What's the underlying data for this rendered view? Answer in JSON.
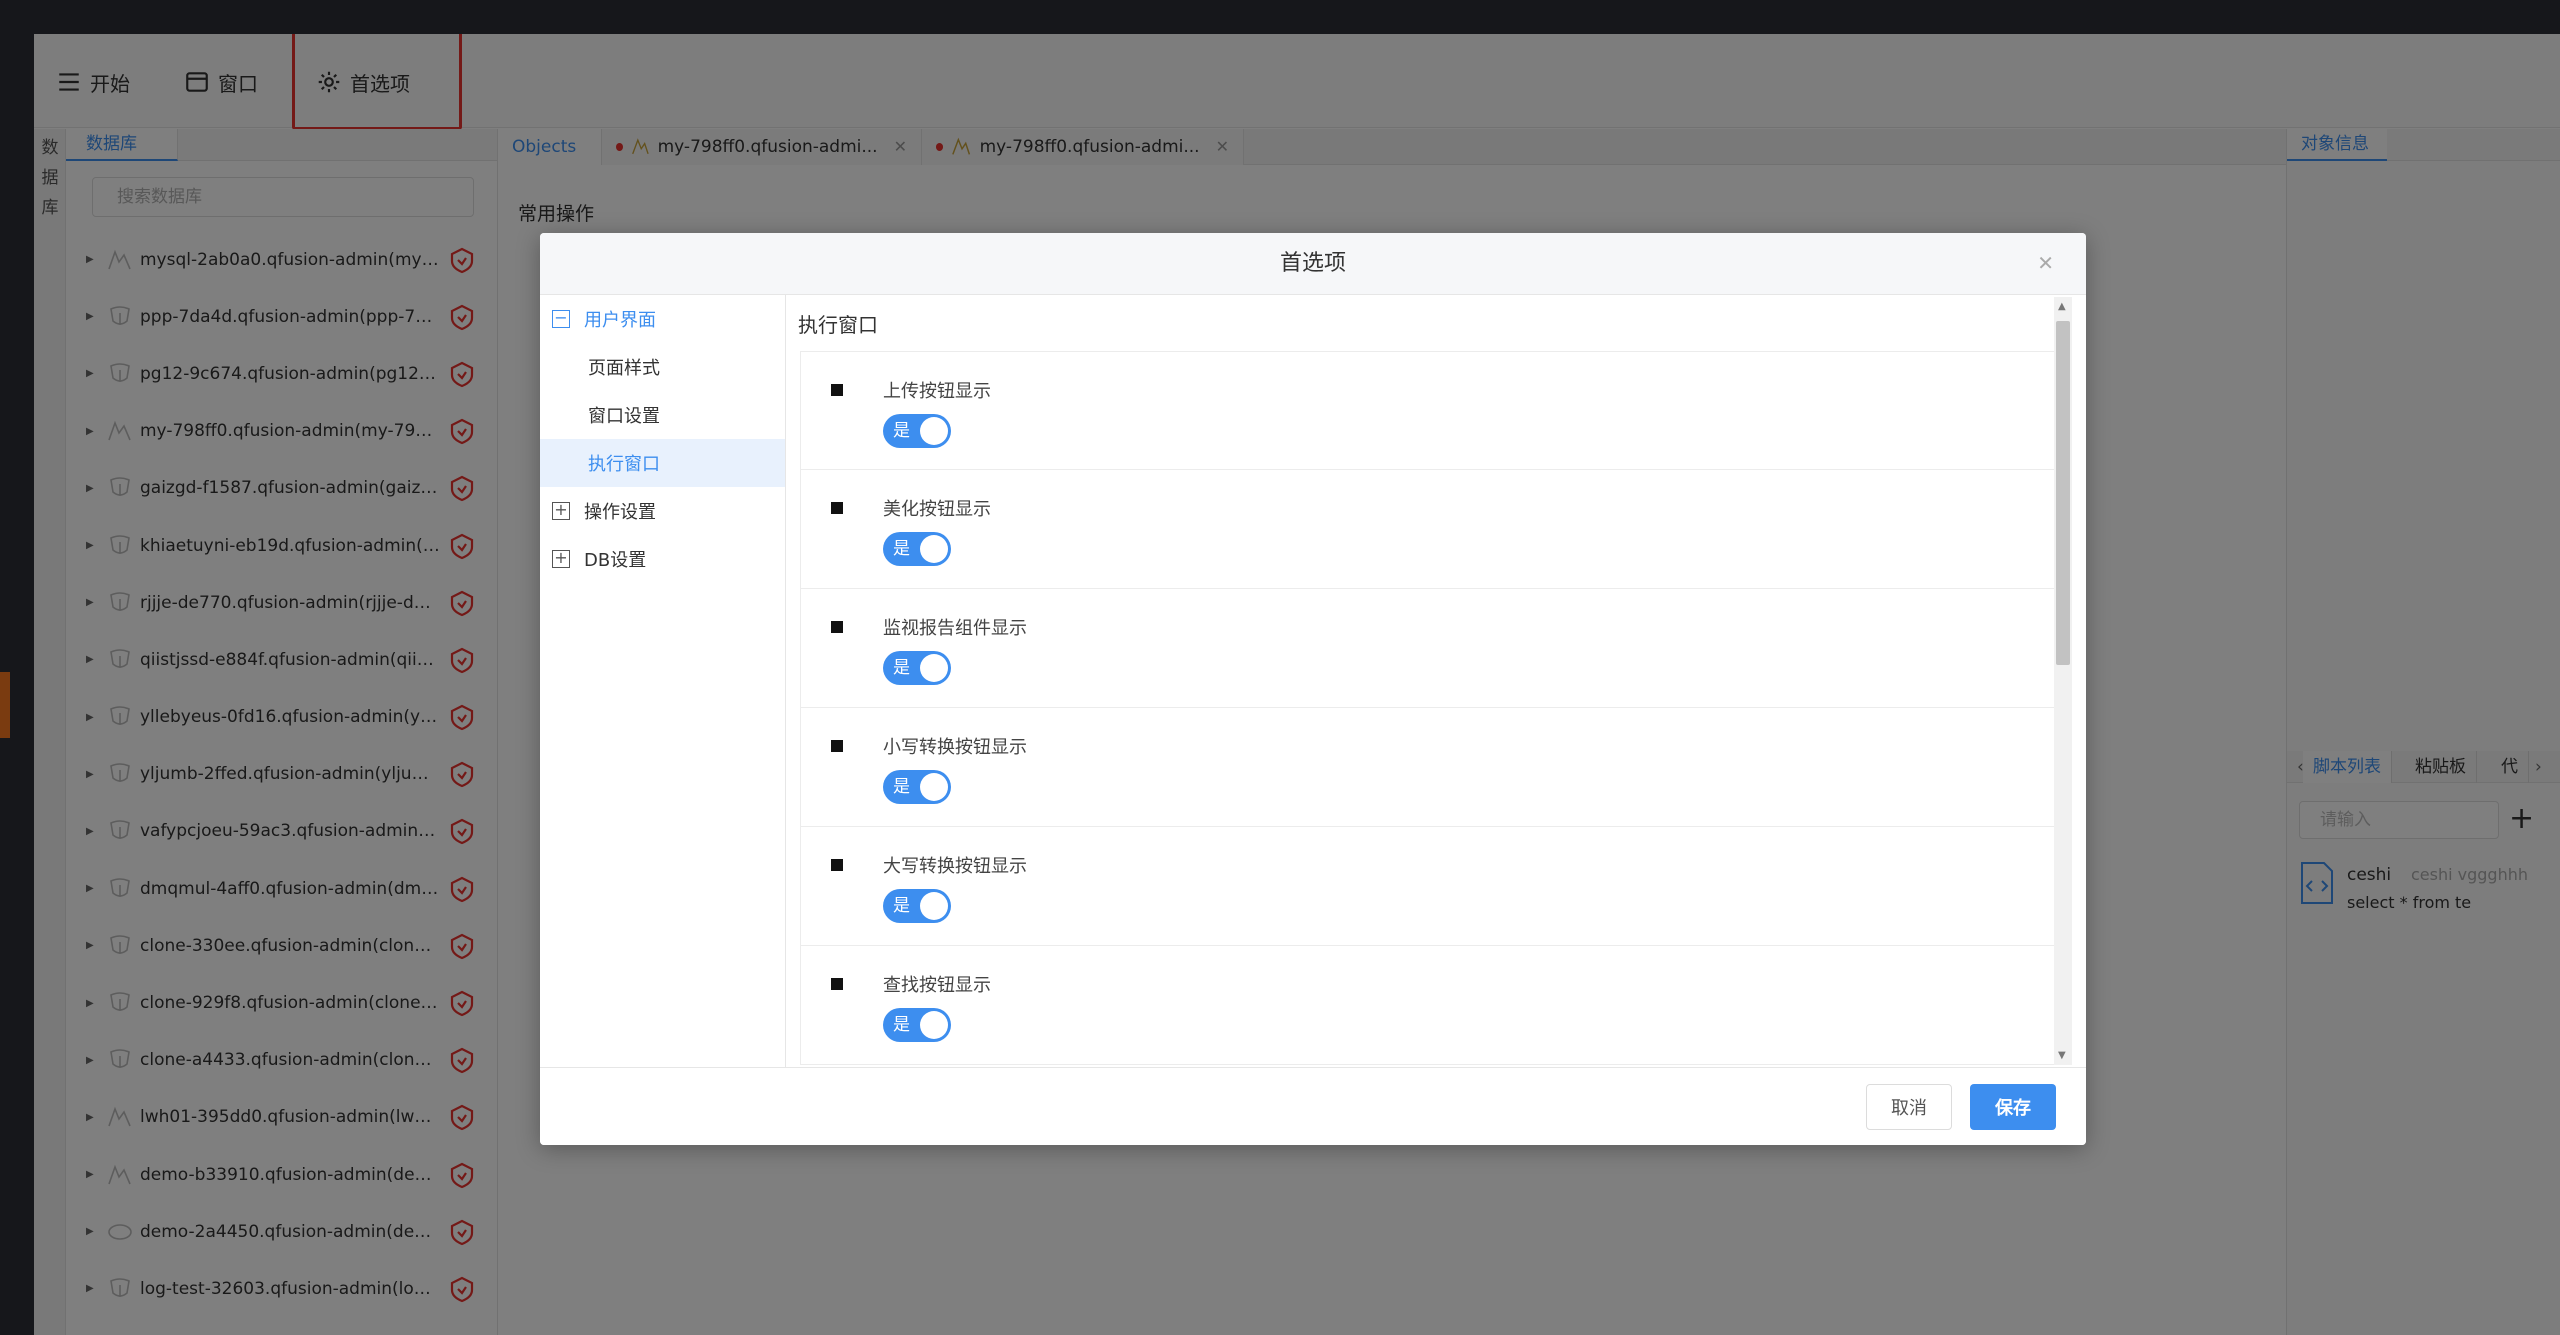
{
  "toolbar": {
    "start_label": "开始",
    "window_label": "窗口",
    "prefs_label": "首选项"
  },
  "left_strip": {
    "label_chars": [
      "数",
      "据",
      "库"
    ]
  },
  "left_panel": {
    "tab_label": "数据库",
    "search_placeholder": "搜索数据库",
    "items": [
      {
        "name": "mysql-2ab0a0.qfusion-admin(mys..."
      },
      {
        "name": "ppp-7da4d.qfusion-admin(ppp-7da..."
      },
      {
        "name": "pg12-9c674.qfusion-admin(pg12-9..."
      },
      {
        "name": "my-798ff0.qfusion-admin(my-798ff..."
      },
      {
        "name": "gaizgd-f1587.qfusion-admin(gaizg..."
      },
      {
        "name": "khiaetuyni-eb19d.qfusion-admin(k..."
      },
      {
        "name": "rjjje-de770.qfusion-admin(rjjje-de7..."
      },
      {
        "name": "qiistjssd-e884f.qfusion-admin(qiist..."
      },
      {
        "name": "yllebyeus-0fd16.qfusion-admin(ylle..."
      },
      {
        "name": "yljumb-2ffed.qfusion-admin(yljumb..."
      },
      {
        "name": "vafypcjoeu-59ac3.qfusion-admin(v..."
      },
      {
        "name": "dmqmul-4aff0.qfusion-admin(dmq..."
      },
      {
        "name": "clone-330ee.qfusion-admin(clone-..."
      },
      {
        "name": "clone-929f8.qfusion-admin(clone-9..."
      },
      {
        "name": "clone-a4433.qfusion-admin(clone-..."
      },
      {
        "name": "lwh01-395dd0.qfusion-admin(lwh0..."
      },
      {
        "name": "demo-b33910.qfusion-admin(dem..."
      },
      {
        "name": "demo-2a4450.qfusion-admin(dem..."
      },
      {
        "name": "log-test-32603.qfusion-admin(log-t..."
      }
    ]
  },
  "center": {
    "tabs": [
      {
        "label": "Objects"
      },
      {
        "label": "my-798ff0.qfusion-admi..."
      },
      {
        "label": "my-798ff0.qfusion-admi..."
      }
    ],
    "section_title": "常用操作"
  },
  "right_panel": {
    "tab_label": "对象信息",
    "lower_tabs": [
      "脚本列表",
      "粘贴板",
      "代"
    ],
    "input_placeholder": "请输入",
    "script": {
      "name": "ceshi",
      "desc": "ceshi vggghhh",
      "sql": "select * from te"
    }
  },
  "dialog": {
    "title": "首选项",
    "nav": [
      {
        "label": "用户界面",
        "expander": "−"
      },
      {
        "label": "页面样式"
      },
      {
        "label": "窗口设置"
      },
      {
        "label": "执行窗口"
      },
      {
        "label": "操作设置",
        "expander": "+"
      },
      {
        "label": "DB设置",
        "expander": "+"
      }
    ],
    "content_title": "执行窗口",
    "settings": [
      {
        "label": "上传按钮显示",
        "toggle_text": "是"
      },
      {
        "label": "美化按钮显示",
        "toggle_text": "是"
      },
      {
        "label": "监视报告组件显示",
        "toggle_text": "是"
      },
      {
        "label": "小写转换按钮显示",
        "toggle_text": "是"
      },
      {
        "label": "大写转换按钮显示",
        "toggle_text": "是"
      },
      {
        "label": "查找按钮显示",
        "toggle_text": "是"
      }
    ],
    "cancel_label": "取消",
    "save_label": "保存"
  },
  "colors": {
    "accent": "#3d8eef",
    "highlight": "#e8322e",
    "db_badge": "#e8322e"
  }
}
